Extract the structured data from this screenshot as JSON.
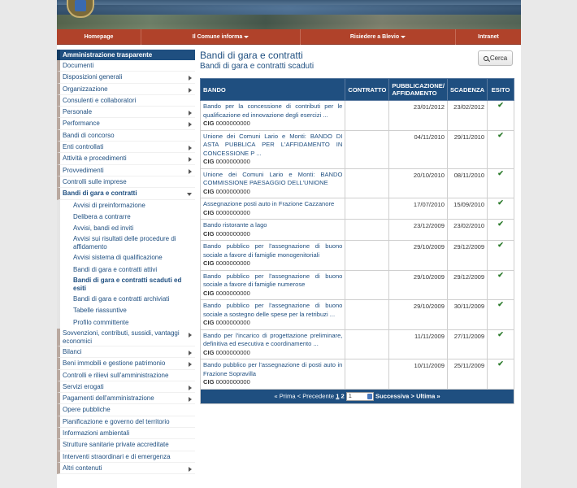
{
  "nav": [
    "Homepage",
    "Il Comune informa",
    "Risiedere a Blevio",
    "Intranet"
  ],
  "sidebar": {
    "header": "Amministrazione trasparente",
    "items_before": [
      {
        "label": "Documenti",
        "arrow": false
      },
      {
        "label": "Disposizioni generali",
        "arrow": true
      },
      {
        "label": "Organizzazione",
        "arrow": true
      },
      {
        "label": "Consulenti e collaboratori",
        "arrow": false
      },
      {
        "label": "Personale",
        "arrow": true
      },
      {
        "label": "Performance",
        "arrow": true
      },
      {
        "label": "Bandi di concorso",
        "arrow": false
      },
      {
        "label": "Enti controllati",
        "arrow": true
      },
      {
        "label": "Attività e procedimenti",
        "arrow": true
      },
      {
        "label": "Provvedimenti",
        "arrow": true
      },
      {
        "label": "Controlli sulle imprese",
        "arrow": false
      }
    ],
    "active_item": "Bandi di gara e contratti",
    "sub_items": [
      "Avvisi di preinformazione",
      "Delibera a contrarre",
      "Avvisi, bandi ed inviti",
      "Avvisi sui risultati delle procedure di affidamento",
      "Avvisi sistema di qualificazione",
      "Bandi di gara e contratti attivi",
      "Bandi di gara e contratti scaduti ed esiti",
      "Bandi di gara e contratti archiviati",
      "Tabelle riassuntive",
      "Profilo committente"
    ],
    "active_sub": "Bandi di gara e contratti scaduti ed esiti",
    "items_after": [
      {
        "label": "Sovvenzioni, contributi, sussidi, vantaggi economici",
        "arrow": true
      },
      {
        "label": "Bilanci",
        "arrow": true
      },
      {
        "label": "Beni immobili e gestione patrimonio",
        "arrow": true
      },
      {
        "label": "Controlli e rilievi sull'amministrazione",
        "arrow": false
      },
      {
        "label": "Servizi erogati",
        "arrow": true
      },
      {
        "label": "Pagamenti dell'amministrazione",
        "arrow": true
      },
      {
        "label": "Opere pubbliche",
        "arrow": false
      },
      {
        "label": "Pianificazione e governo del territorio",
        "arrow": false
      },
      {
        "label": "Informazioni ambientali",
        "arrow": false
      },
      {
        "label": "Strutture sanitarie private accreditate",
        "arrow": false
      },
      {
        "label": "Interventi straordinari e di emergenza",
        "arrow": false
      },
      {
        "label": "Altri contenuti",
        "arrow": true
      }
    ]
  },
  "content": {
    "title": "Bandi di gara e contratti",
    "subtitle": "Bandi di gara e contratti scaduti",
    "search_label": "Cerca"
  },
  "table": {
    "headers": [
      "BANDO",
      "CONTRATTO",
      "PUBBLICAZIONE/ AFFIDAMENTO",
      "SCADENZA",
      "ESITO"
    ],
    "cig_label": "CIG",
    "rows": [
      {
        "bando": "Bando per la concessione di contributi per le qualificazione ed innovazione degli esercizi ...",
        "cig": "0000000000",
        "contratto": "",
        "pubblicazione": "23/01/2012",
        "scadenza": "23/02/2012",
        "esito": "✔"
      },
      {
        "bando": "Unione dei Comuni Lario e Monti: BANDO DI ASTA PUBBLICA PER L'AFFIDAMENTO IN CONCESSIONE P ...",
        "cig": "0000000000",
        "contratto": "",
        "pubblicazione": "04/11/2010",
        "scadenza": "29/11/2010",
        "esito": "✔"
      },
      {
        "bando": "Unione dei Comuni Lario e Monti: BANDO COMMISSIONE PAESAGGIO DELL'UNIONE",
        "cig": "0000000000",
        "contratto": "",
        "pubblicazione": "20/10/2010",
        "scadenza": "08/11/2010",
        "esito": "✔"
      },
      {
        "bando": "Assegnazione posti auto in Frazione Cazzanore",
        "cig": "0000000000",
        "contratto": "",
        "pubblicazione": "17/07/2010",
        "scadenza": "15/09/2010",
        "esito": "✔"
      },
      {
        "bando": "Bando ristorante a lago",
        "cig": "0000000000",
        "contratto": "",
        "pubblicazione": "23/12/2009",
        "scadenza": "23/02/2010",
        "esito": "✔"
      },
      {
        "bando": "Bando pubblico per l'assegnazione di buono sociale a favore di famiglie monogenitoriali",
        "cig": "0000000000",
        "contratto": "",
        "pubblicazione": "29/10/2009",
        "scadenza": "29/12/2009",
        "esito": "✔"
      },
      {
        "bando": "Bando pubblico per l'assegnazione di buono sociale a favore di famiglie numerose",
        "cig": "0000000000",
        "contratto": "",
        "pubblicazione": "29/10/2009",
        "scadenza": "29/12/2009",
        "esito": "✔"
      },
      {
        "bando": "Bando pubblico per l'assegnazione di buono sociale a sostegno delle spese per la retribuzi ...",
        "cig": "0000000000",
        "contratto": "",
        "pubblicazione": "29/10/2009",
        "scadenza": "30/11/2009",
        "esito": "✔"
      },
      {
        "bando": "Bando per l'incarico di progettazione preliminare, definitiva ed esecutiva e coordinamento ...",
        "cig": "0000000000",
        "contratto": "",
        "pubblicazione": "11/11/2009",
        "scadenza": "27/11/2009",
        "esito": "✔"
      },
      {
        "bando": "Bando pubblico per l'assegnazione di posti auto in Frazione Sopravilla",
        "cig": "0000000000",
        "contratto": "",
        "pubblicazione": "10/11/2009",
        "scadenza": "25/11/2009",
        "esito": "✔"
      }
    ]
  },
  "pager": {
    "prima": "« Prima",
    "precedente": "< Precedente",
    "page1": "1",
    "page2": "2",
    "select_value": "1",
    "successiva": "Successiva >",
    "ultima": "Ultima »"
  }
}
